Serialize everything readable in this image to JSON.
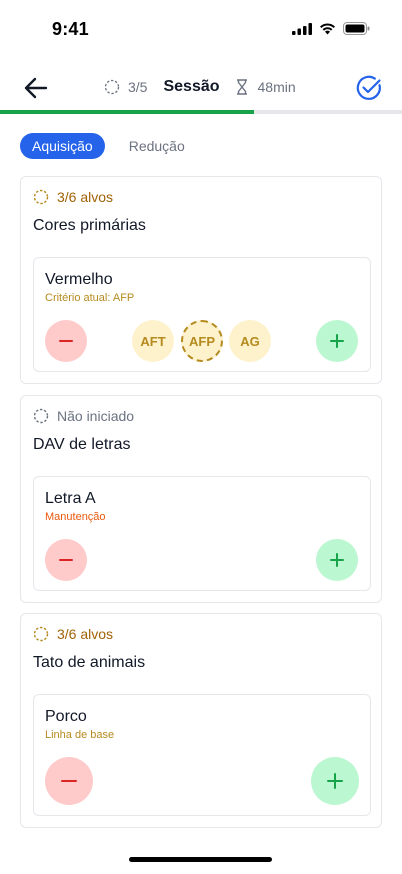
{
  "status_bar": {
    "time": "9:41"
  },
  "header": {
    "progress": "3/5",
    "title": "Sessão",
    "timer": "48min"
  },
  "progress": {
    "fraction": 0.632,
    "color": "#16a34a"
  },
  "tabs": [
    {
      "label": "Aquisição",
      "active": true
    },
    {
      "label": "Redução",
      "active": false
    }
  ],
  "cards": [
    {
      "status": "3/6 alvos",
      "status_color": "#a16207",
      "title": "Cores primárias",
      "item": {
        "name": "Vermelho",
        "subtitle": "Critério atual: AFP",
        "subtitle_color": "#b58a1e",
        "chips": [
          "AFT",
          "AFP",
          "AG"
        ],
        "current_chip": "AFP"
      }
    },
    {
      "status": "Não iniciado",
      "status_color": "#6b7280",
      "title": "DAV de letras",
      "item": {
        "name": "Letra A",
        "subtitle": "Manutenção",
        "subtitle_color": "#ea580c"
      }
    },
    {
      "status": "3/6 alvos",
      "status_color": "#a16207",
      "title": "Tato de animais",
      "item": {
        "name": "Porco",
        "subtitle": "Linha de base",
        "subtitle_color": "#b58a1e"
      }
    }
  ],
  "colors": {
    "accent": "#2563eb",
    "minus_bg": "#fecaca",
    "minus_fg": "#dc2626",
    "plus_bg": "#bbf7d0",
    "plus_fg": "#16a34a"
  },
  "icons": [
    "back-arrow-icon",
    "dashed-circle-icon",
    "hourglass-icon",
    "check-circle-icon",
    "minus-icon",
    "plus-icon",
    "signal-icon",
    "wifi-icon",
    "battery-icon"
  ]
}
